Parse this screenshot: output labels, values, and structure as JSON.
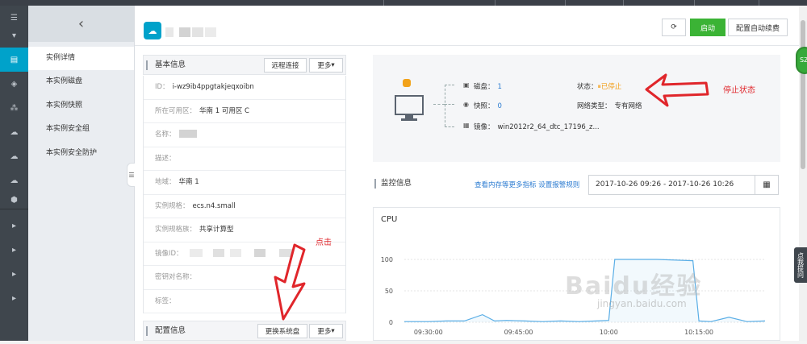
{
  "header": {
    "refresh_icon": "refresh-icon",
    "start_label": "启动",
    "auto_renew_label": "配置自动续费"
  },
  "subnav": {
    "back_icon": "chevron-left-icon",
    "items": [
      {
        "label": "实例详情"
      },
      {
        "label": "本实例磁盘"
      },
      {
        "label": "本实例快照"
      },
      {
        "label": "本实例安全组"
      },
      {
        "label": "本实例安全防护"
      }
    ]
  },
  "basic_info": {
    "title": "基本信息",
    "remote_label": "远程连接",
    "more_label": "更多",
    "rows": [
      {
        "label": "ID：",
        "value": "i-wz9ib4ppgtakjeqxoibn"
      },
      {
        "label": "所在可用区：",
        "value": "华南 1 可用区 C"
      },
      {
        "label": "名称：",
        "value": ""
      },
      {
        "label": "描述：",
        "value": ""
      },
      {
        "label": "地域：",
        "value": "华南 1"
      },
      {
        "label": "实例规格：",
        "value": "ecs.n4.small"
      },
      {
        "label": "实例规格族：",
        "value": "共享计算型"
      },
      {
        "label": "镜像ID：",
        "value": ""
      },
      {
        "label": "密钥对名称：",
        "value": ""
      },
      {
        "label": "标签：",
        "value": ""
      }
    ]
  },
  "config_info": {
    "title": "配置信息",
    "change_disk_label": "更换系统盘",
    "more_label": "更多"
  },
  "summary": {
    "disk_label": "磁盘：",
    "disk_value": "1",
    "snapshot_label": "快照：",
    "snapshot_value": "0",
    "image_label": "镜像：",
    "image_value": "win2012r2_64_dtc_17196_z...",
    "status_label": "状态：",
    "status_value": "已停止",
    "network_label": "网络类型：",
    "network_value": "专有网络"
  },
  "annotations": {
    "stop_status": "停止状态",
    "click": "点击"
  },
  "monitor": {
    "title": "监控信息",
    "link_more": "查看内存等更多指标",
    "link_alarm": "设置报警规则",
    "date_range": "2017-10-26 09:26  -  2017-10-26 10:26"
  },
  "side": {
    "green_badge": "SZ",
    "vertical_tab": "点我提问",
    "watermark": "Baidu经验",
    "watermark_url": "jingyan.baidu.com"
  },
  "colors": {
    "accent": "#00a2ca",
    "start_green": "#3bb335",
    "status_orange": "#f39c12",
    "line": "#5aaee6",
    "annot_red": "#e0262b"
  },
  "chart_data": {
    "type": "line",
    "title": "CPU",
    "xlabel": "",
    "ylabel": "",
    "ylim": [
      0,
      100
    ],
    "yticks": [
      0,
      50,
      100
    ],
    "xticks": [
      "09:30:00",
      "09:45:00",
      "10:00",
      "10:15:00"
    ],
    "series": [
      {
        "x": [
          "09:26",
          "09:30",
          "09:33",
          "09:36",
          "09:39",
          "09:41",
          "09:43",
          "09:46",
          "09:49",
          "09:52",
          "09:55",
          "09:58",
          "10:00",
          "10:01",
          "10:02",
          "10:08",
          "10:14",
          "10:15",
          "10:17",
          "10:20",
          "10:23",
          "10:26"
        ],
        "values": [
          1,
          1,
          2,
          2,
          12,
          2,
          3,
          2,
          1,
          2,
          1,
          2,
          3,
          100,
          100,
          100,
          98,
          2,
          1,
          8,
          1,
          2
        ]
      }
    ]
  }
}
